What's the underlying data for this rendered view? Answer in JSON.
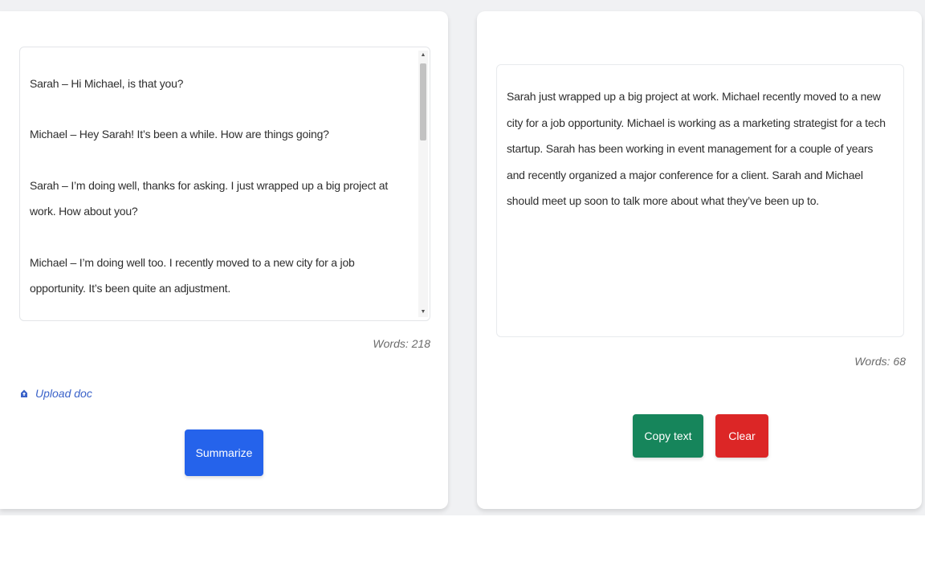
{
  "input": {
    "messages": [
      "Sarah – Hi Michael, is that you?",
      "Michael – Hey Sarah! It’s been a while. How are things going?",
      "Sarah – I’m doing well, thanks for asking. I just wrapped up a big project at work. How about you?",
      "Michael – I’m doing well too. I recently moved to a new city for a job opportunity. It’s been quite an adjustment."
    ],
    "word_count": "Words: 218",
    "upload_label": "Upload doc",
    "summarize_label": "Summarize"
  },
  "output": {
    "summary": "Sarah just wrapped up a big project at work. Michael recently moved to a new city for a job opportunity. Michael is working as a marketing strategist for a tech startup. Sarah has been working in event management for a couple of years and recently organized a major conference for a client. Sarah and Michael should meet up soon to talk more about what they’ve been up to.",
    "word_count": "Words: 68",
    "copy_label": "Copy text",
    "clear_label": "Clear"
  },
  "colors": {
    "summarize": "#2563eb",
    "copy": "#16855b",
    "clear": "#dc2626",
    "link": "#3a62c9"
  },
  "icons": {
    "upload": "cloud-upload-icon",
    "scroll_up": "scroll-up-arrow-icon",
    "scroll_down": "scroll-down-arrow-icon"
  }
}
